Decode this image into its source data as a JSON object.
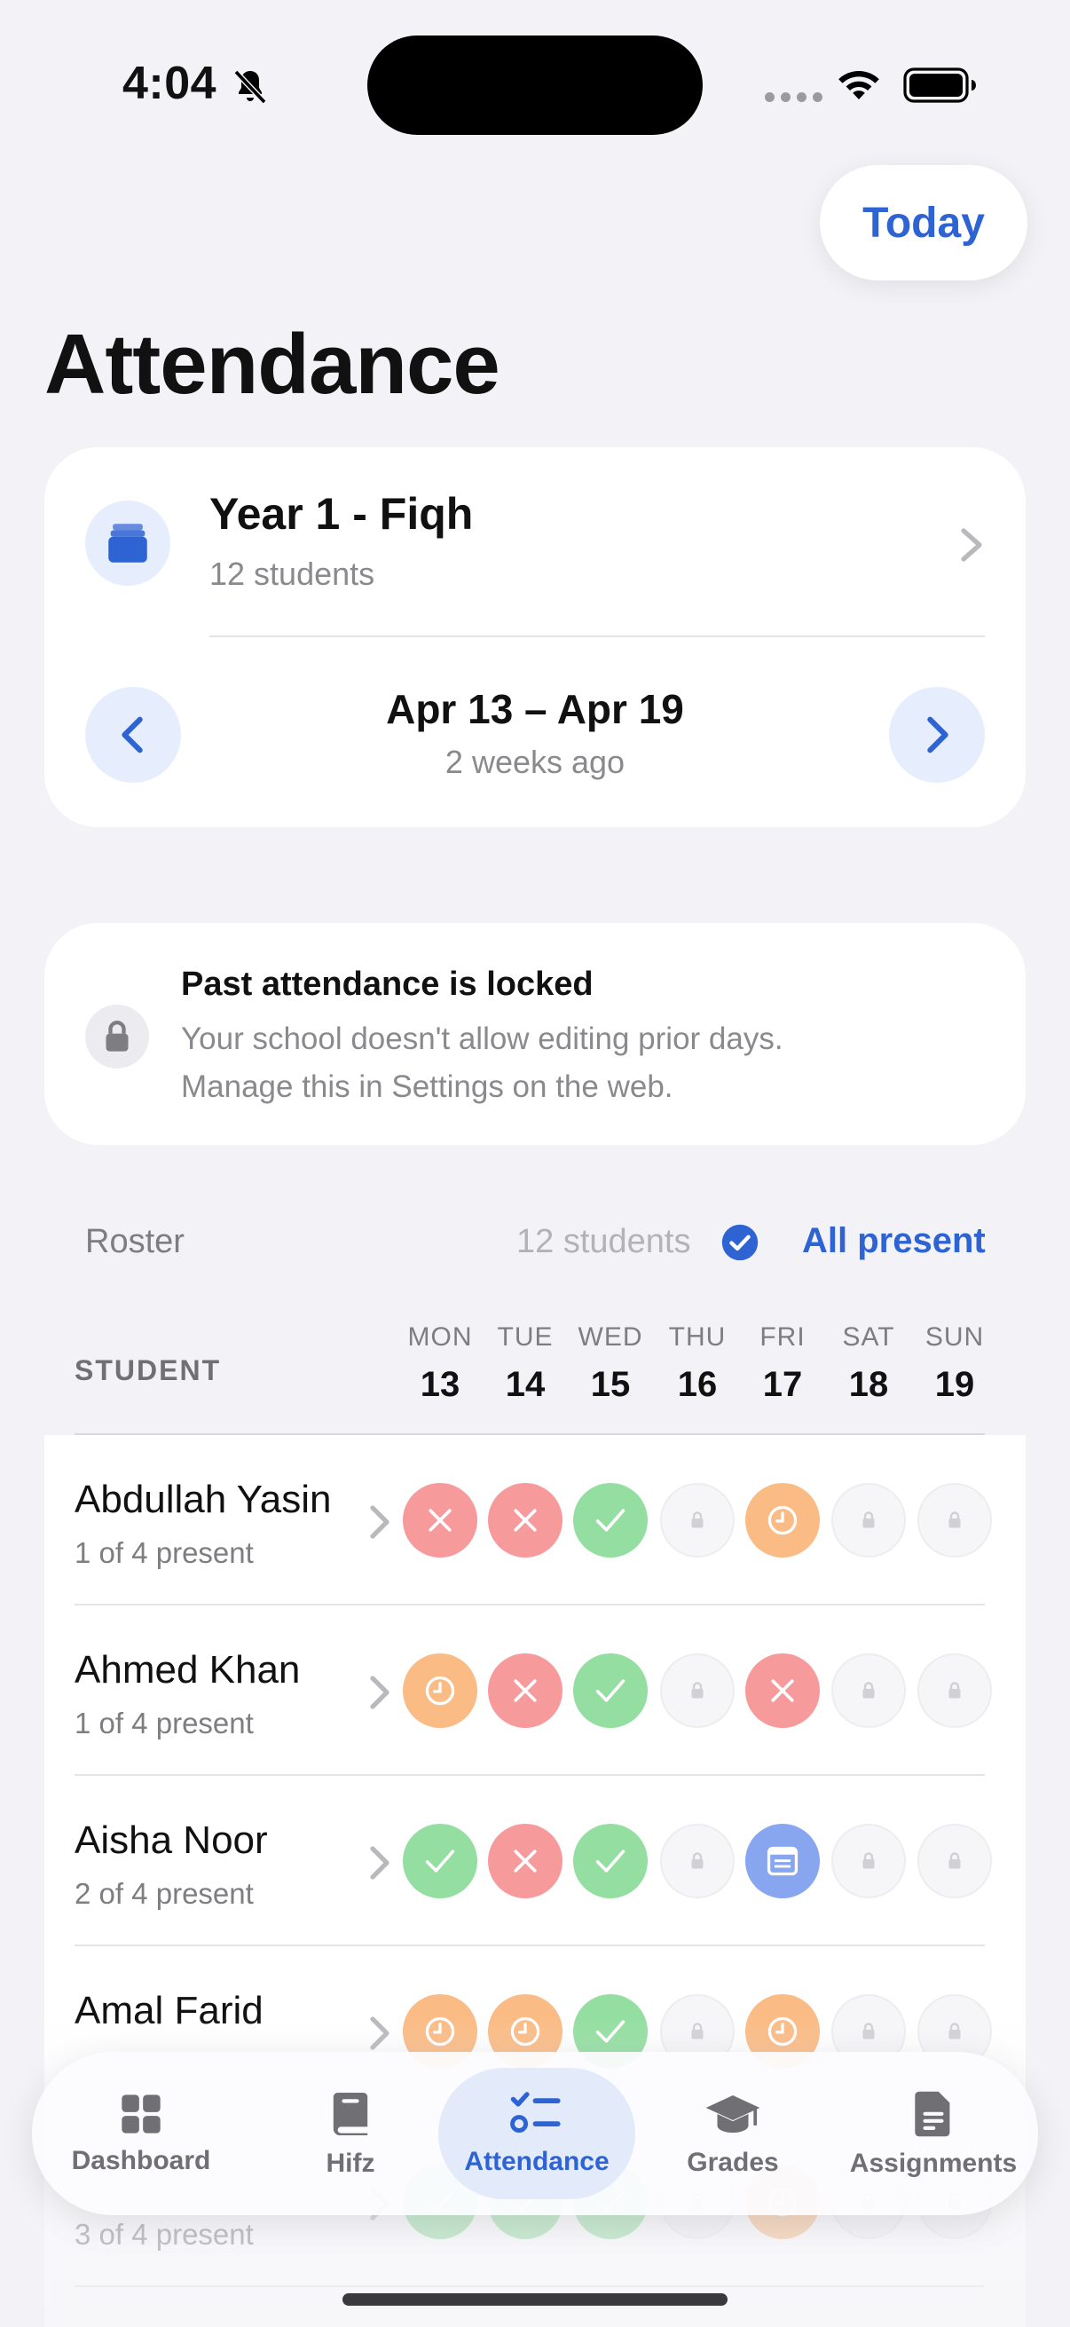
{
  "status_bar": {
    "time": "4:04"
  },
  "header": {
    "today_label": "Today",
    "title": "Attendance"
  },
  "class_card": {
    "name": "Year 1 - Fiqh",
    "students": "12 students",
    "week_range": "Apr 13 – Apr 19",
    "week_relative": "2 weeks ago"
  },
  "lock_notice": {
    "title": "Past attendance is locked",
    "line1": "Your school doesn't allow editing prior days.",
    "line2": "Manage this in Settings on the web."
  },
  "roster": {
    "label": "Roster",
    "count": "12 students",
    "all_present_label": "All present",
    "student_header": "STUDENT",
    "days": [
      {
        "name": "MON",
        "date": "13"
      },
      {
        "name": "TUE",
        "date": "14"
      },
      {
        "name": "WED",
        "date": "15"
      },
      {
        "name": "THU",
        "date": "16"
      },
      {
        "name": "FRI",
        "date": "17"
      },
      {
        "name": "SAT",
        "date": "18"
      },
      {
        "name": "SUN",
        "date": "19"
      }
    ],
    "students": [
      {
        "name": "Abdullah Yasin",
        "summary": "1 of 4 present",
        "marks": [
          "absent",
          "absent",
          "present",
          "locked",
          "late",
          "locked",
          "locked"
        ]
      },
      {
        "name": "Ahmed Khan",
        "summary": "1 of 4 present",
        "marks": [
          "late",
          "absent",
          "present",
          "locked",
          "absent",
          "locked",
          "locked"
        ]
      },
      {
        "name": "Aisha Noor",
        "summary": "2 of 4 present",
        "marks": [
          "present",
          "absent",
          "present",
          "locked",
          "excused",
          "locked",
          "locked"
        ]
      },
      {
        "name": "Amal Farid",
        "summary": "",
        "marks": [
          "late",
          "late",
          "present",
          "locked",
          "late",
          "locked",
          "locked"
        ]
      },
      {
        "name": "",
        "summary": "3 of 4 present",
        "marks": [
          "present",
          "present",
          "present",
          "locked",
          "late",
          "locked",
          "locked"
        ]
      }
    ]
  },
  "status_colors": {
    "absent": "#f79a9c",
    "present": "#93dea0",
    "late": "#fbbb84",
    "excused": "#88a6ef",
    "locked": "#f6f6f8",
    "accent": "#2d63d2"
  },
  "tabs": [
    {
      "label": "Dashboard",
      "icon": "grid-icon",
      "active": false
    },
    {
      "label": "Hifz",
      "icon": "book-icon",
      "active": false
    },
    {
      "label": "Attendance",
      "icon": "checklist-icon",
      "active": true
    },
    {
      "label": "Grades",
      "icon": "graduation-cap-icon",
      "active": false
    },
    {
      "label": "Assignments",
      "icon": "document-icon",
      "active": false
    }
  ]
}
